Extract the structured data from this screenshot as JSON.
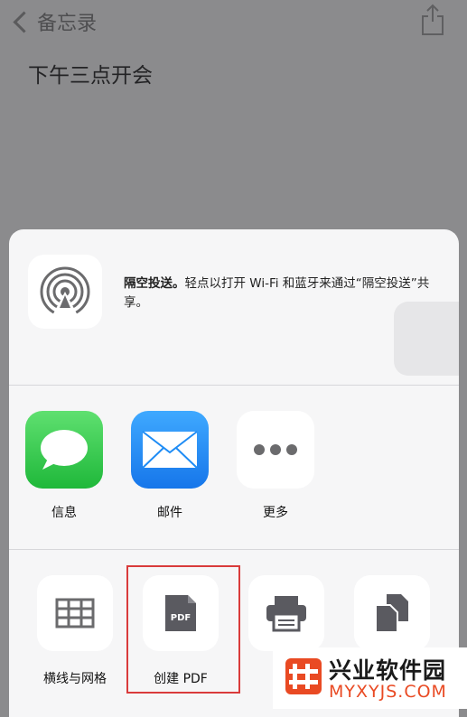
{
  "nav": {
    "back_label": "备忘录"
  },
  "note": {
    "title": "下午三点开会"
  },
  "airdrop": {
    "bold": "隔空投送。",
    "description": "轻点以打开 Wi-Fi 和蓝牙来通过“隔空投送”共享。"
  },
  "apps": [
    {
      "label": "信息",
      "icon": "messages-icon",
      "color": "#34c759"
    },
    {
      "label": "邮件",
      "icon": "mail-icon",
      "color": "#1e8cf5"
    },
    {
      "label": "更多",
      "icon": "more-icon",
      "color": "#ffffff"
    }
  ],
  "actions": [
    {
      "label": "横线与网格",
      "icon": "grid-icon"
    },
    {
      "label": "创建 PDF",
      "icon": "pdf-icon",
      "icon_text": "PDF"
    },
    {
      "label": "",
      "icon": "print-icon"
    },
    {
      "label": "",
      "icon": "copy-icon"
    }
  ],
  "watermark": {
    "title": "兴业软件园",
    "url": "MYXYJS.COM"
  },
  "colors": {
    "highlight": "#d93b3b",
    "watermark_accent": "#e94a23"
  }
}
